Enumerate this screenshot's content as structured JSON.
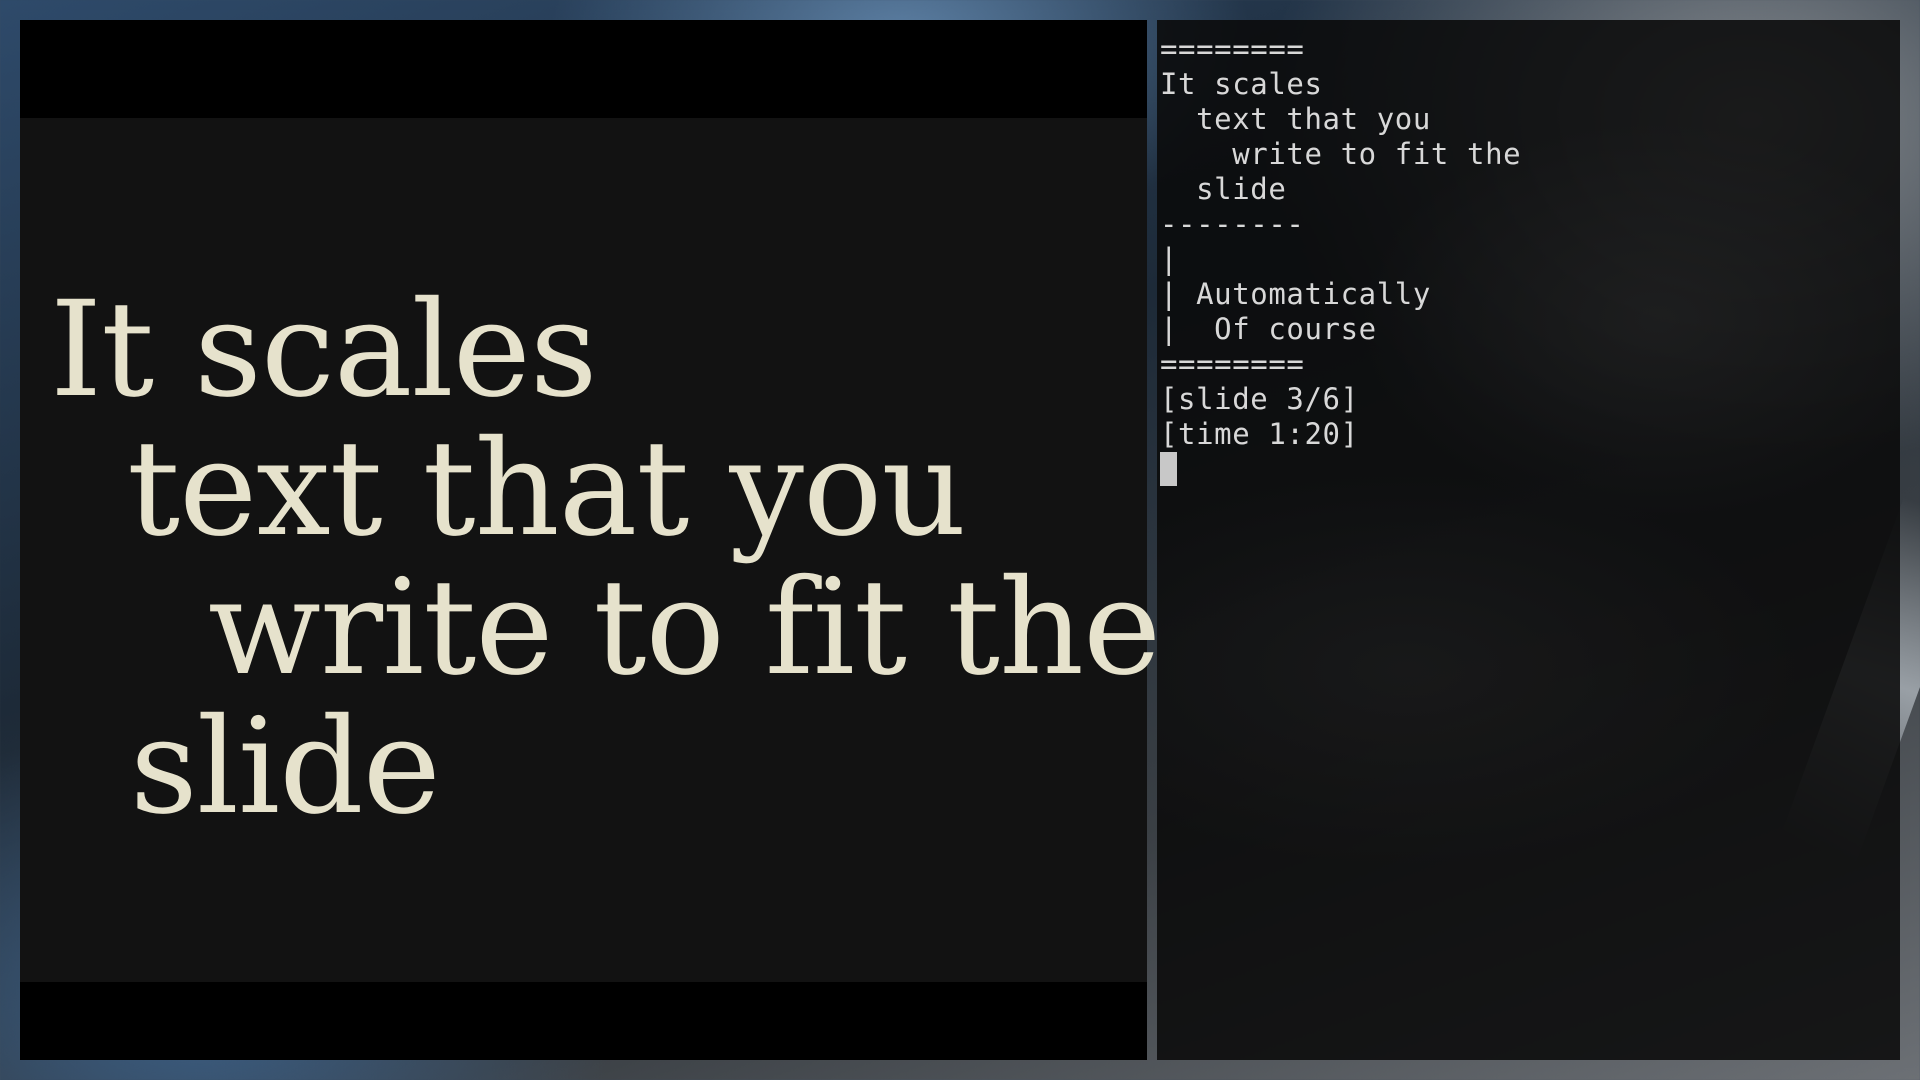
{
  "slide": {
    "lines": [
      "It scales",
      "text that you",
      "write to fit the",
      "slide"
    ]
  },
  "terminal": {
    "lines": [
      "========",
      "It scales",
      "  text that you",
      "    write to fit the",
      "  slide",
      "--------",
      "|",
      "| Automatically",
      "|  Of course",
      "========",
      "[slide 3/6]",
      "[time 1:20]"
    ]
  }
}
